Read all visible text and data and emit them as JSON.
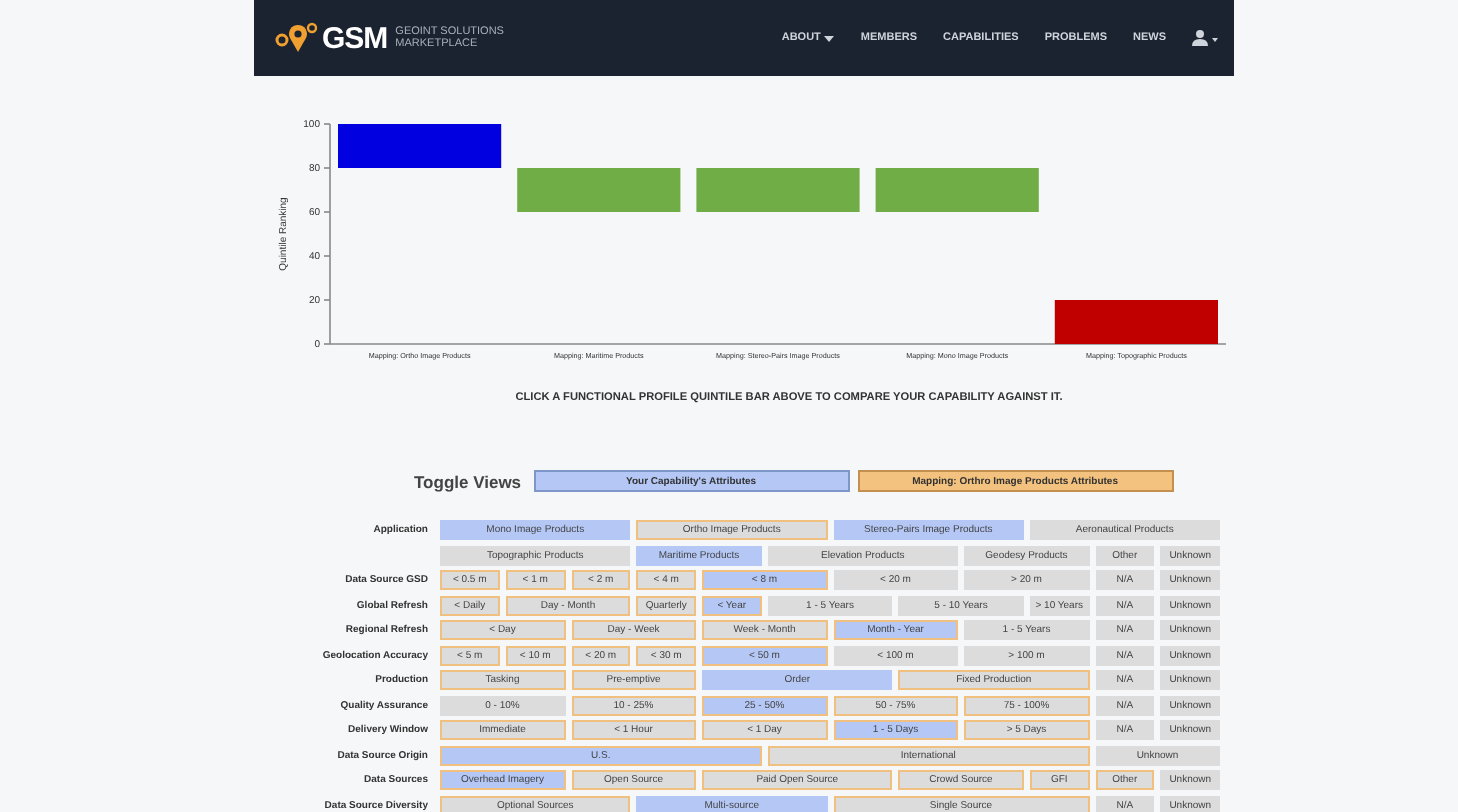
{
  "navbar": {
    "logo": "GSM",
    "tagline": [
      "GEOINT SOLUTIONS",
      "MARKETPLACE"
    ],
    "menu": [
      {
        "label": "ABOUT",
        "dropdown": true
      },
      {
        "label": "MEMBERS",
        "dropdown": false
      },
      {
        "label": "CAPABILITIES",
        "dropdown": false
      },
      {
        "label": "PROBLEMS",
        "dropdown": false
      },
      {
        "label": "NEWS",
        "dropdown": false
      }
    ]
  },
  "chart": {
    "chart_data": {
      "type": "candlestick",
      "ylabel": "Quintile Ranking",
      "categories": [
        "Mapping: Ortho Image Products",
        "Mapping: Maritime Products",
        "Mapping: Stereo-Pairs Image Products",
        "Mapping: Mono Image Products",
        "Mapping: Topographic Products"
      ],
      "ylim": [
        0,
        100
      ],
      "yticks": [
        0,
        20,
        40,
        60,
        80,
        100
      ],
      "series": [
        {
          "color": "#0000e0",
          "ohlc": [
            [
              80,
              100,
              80,
              100
            ],
            null,
            null,
            null,
            null
          ]
        },
        {
          "color": "#70ad47",
          "ohlc": [
            null,
            [
              60,
              80,
              60,
              80
            ],
            [
              60,
              80,
              60,
              80
            ],
            [
              60,
              80,
              60,
              80
            ],
            null
          ]
        },
        {
          "color": "#c00000",
          "ohlc": [
            null,
            null,
            null,
            null,
            [
              0,
              20,
              0,
              20
            ]
          ]
        }
      ]
    },
    "caption": "CLICK A FUNCTIONAL PROFILE QUINTILE BAR ABOVE TO COMPARE YOUR CAPABILITY AGAINST IT."
  },
  "toggle": {
    "label": "Toggle Views",
    "buttons": [
      {
        "label": "Your Capability's Attributes",
        "kind": "mine"
      },
      {
        "label": "Mapping: Orthro Image Products Attributes",
        "kind": "profile"
      }
    ]
  },
  "attributes": [
    {
      "label": "Application",
      "lines": [
        [
          {
            "text": "Mono Image Products",
            "mine": true,
            "profile": false
          },
          {
            "text": "Ortho Image Products",
            "mine": false,
            "profile": true
          },
          {
            "text": "Stereo-Pairs Image Products",
            "mine": true,
            "profile": false
          },
          {
            "text": "Aeronautical Products",
            "mine": false,
            "profile": false
          }
        ],
        [
          {
            "text": "Topographic Products",
            "mine": false,
            "profile": false
          },
          {
            "text": "Maritime Products",
            "mine": true,
            "profile": false
          },
          {
            "text": "Elevation Products",
            "mine": false,
            "profile": false
          },
          {
            "text": "Geodesy Products",
            "mine": false,
            "profile": false
          },
          {
            "text": "Other",
            "mine": false,
            "profile": false
          },
          {
            "text": "Unknown",
            "mine": false,
            "profile": false
          }
        ]
      ]
    },
    {
      "label": "Data Source GSD",
      "lines": [
        [
          {
            "text": "< 0.5 m",
            "mine": false,
            "profile": true
          },
          {
            "text": "< 1 m",
            "mine": false,
            "profile": true
          },
          {
            "text": "< 2 m",
            "mine": false,
            "profile": true
          },
          {
            "text": "< 4 m",
            "mine": false,
            "profile": true
          },
          {
            "text": "< 8 m",
            "mine": true,
            "profile": true
          },
          {
            "text": "< 20 m",
            "mine": false,
            "profile": false
          },
          {
            "text": "> 20 m",
            "mine": false,
            "profile": false
          },
          {
            "text": "N/A",
            "mine": false,
            "profile": false
          },
          {
            "text": "Unknown",
            "mine": false,
            "profile": false
          }
        ]
      ]
    },
    {
      "label": "Global Refresh",
      "lines": [
        [
          {
            "text": "< Daily",
            "mine": false,
            "profile": true
          },
          {
            "text": "Day - Month",
            "mine": false,
            "profile": true
          },
          {
            "text": "Quarterly",
            "mine": false,
            "profile": true
          },
          {
            "text": "< Year",
            "mine": true,
            "profile": true
          },
          {
            "text": "1 - 5 Years",
            "mine": false,
            "profile": false
          },
          {
            "text": "5 - 10 Years",
            "mine": false,
            "profile": false
          },
          {
            "text": "> 10 Years",
            "mine": false,
            "profile": false
          },
          {
            "text": "N/A",
            "mine": false,
            "profile": false
          },
          {
            "text": "Unknown",
            "mine": false,
            "profile": false
          }
        ]
      ]
    },
    {
      "label": "Regional Refresh",
      "lines": [
        [
          {
            "text": "< Day",
            "mine": false,
            "profile": true
          },
          {
            "text": "Day - Week",
            "mine": false,
            "profile": true
          },
          {
            "text": "Week - Month",
            "mine": false,
            "profile": true
          },
          {
            "text": "Month - Year",
            "mine": true,
            "profile": true
          },
          {
            "text": "1 - 5 Years",
            "mine": false,
            "profile": false
          },
          {
            "text": "N/A",
            "mine": false,
            "profile": false
          },
          {
            "text": "Unknown",
            "mine": false,
            "profile": false
          }
        ]
      ]
    },
    {
      "label": "Geolocation Accuracy",
      "lines": [
        [
          {
            "text": "< 5 m",
            "mine": false,
            "profile": true
          },
          {
            "text": "< 10 m",
            "mine": false,
            "profile": true
          },
          {
            "text": "< 20 m",
            "mine": false,
            "profile": true
          },
          {
            "text": "< 30 m",
            "mine": false,
            "profile": true
          },
          {
            "text": "< 50 m",
            "mine": true,
            "profile": true
          },
          {
            "text": "< 100 m",
            "mine": false,
            "profile": false
          },
          {
            "text": "> 100 m",
            "mine": false,
            "profile": false
          },
          {
            "text": "N/A",
            "mine": false,
            "profile": false
          },
          {
            "text": "Unknown",
            "mine": false,
            "profile": false
          }
        ]
      ]
    },
    {
      "label": "Production",
      "lines": [
        [
          {
            "text": "Tasking",
            "mine": false,
            "profile": true
          },
          {
            "text": "Pre-emptive",
            "mine": false,
            "profile": true
          },
          {
            "text": "Order",
            "mine": true,
            "profile": false
          },
          {
            "text": "Fixed Production",
            "mine": false,
            "profile": true
          },
          {
            "text": "N/A",
            "mine": false,
            "profile": false
          },
          {
            "text": "Unknown",
            "mine": false,
            "profile": false
          }
        ]
      ]
    },
    {
      "label": "Quality Assurance",
      "lines": [
        [
          {
            "text": "0 - 10%",
            "mine": false,
            "profile": false
          },
          {
            "text": "10 - 25%",
            "mine": false,
            "profile": true
          },
          {
            "text": "25 - 50%",
            "mine": true,
            "profile": true
          },
          {
            "text": "50 - 75%",
            "mine": false,
            "profile": true
          },
          {
            "text": "75 - 100%",
            "mine": false,
            "profile": true
          },
          {
            "text": "N/A",
            "mine": false,
            "profile": false
          },
          {
            "text": "Unknown",
            "mine": false,
            "profile": false
          }
        ]
      ]
    },
    {
      "label": "Delivery Window",
      "lines": [
        [
          {
            "text": "Immediate",
            "mine": false,
            "profile": true
          },
          {
            "text": "< 1 Hour",
            "mine": false,
            "profile": true
          },
          {
            "text": "< 1 Day",
            "mine": false,
            "profile": true
          },
          {
            "text": "1 - 5 Days",
            "mine": true,
            "profile": true
          },
          {
            "text": "> 5 Days",
            "mine": false,
            "profile": true
          },
          {
            "text": "N/A",
            "mine": false,
            "profile": false
          },
          {
            "text": "Unknown",
            "mine": false,
            "profile": false
          }
        ]
      ]
    },
    {
      "label": "Data Source Origin",
      "lines": [
        [
          {
            "text": "U.S.",
            "mine": true,
            "profile": true
          },
          {
            "text": "International",
            "mine": false,
            "profile": true
          },
          {
            "text": "Unknown",
            "mine": false,
            "profile": false
          }
        ]
      ]
    },
    {
      "label": "Data Sources",
      "lines": [
        [
          {
            "text": "Overhead Imagery",
            "mine": true,
            "profile": true
          },
          {
            "text": "Open Source",
            "mine": false,
            "profile": true
          },
          {
            "text": "Paid Open Source",
            "mine": false,
            "profile": true
          },
          {
            "text": "Crowd Source",
            "mine": false,
            "profile": true
          },
          {
            "text": "GFI",
            "mine": false,
            "profile": true
          },
          {
            "text": "Other",
            "mine": false,
            "profile": true
          },
          {
            "text": "Unknown",
            "mine": false,
            "profile": false
          }
        ]
      ]
    },
    {
      "label": "Data Source Diversity",
      "lines": [
        [
          {
            "text": "Optional Sources",
            "mine": false,
            "profile": true
          },
          {
            "text": "Multi-source",
            "mine": true,
            "profile": false
          },
          {
            "text": "Single Source",
            "mine": false,
            "profile": true
          },
          {
            "text": "N/A",
            "mine": false,
            "profile": false
          },
          {
            "text": "Unknown",
            "mine": false,
            "profile": false
          }
        ]
      ]
    }
  ]
}
